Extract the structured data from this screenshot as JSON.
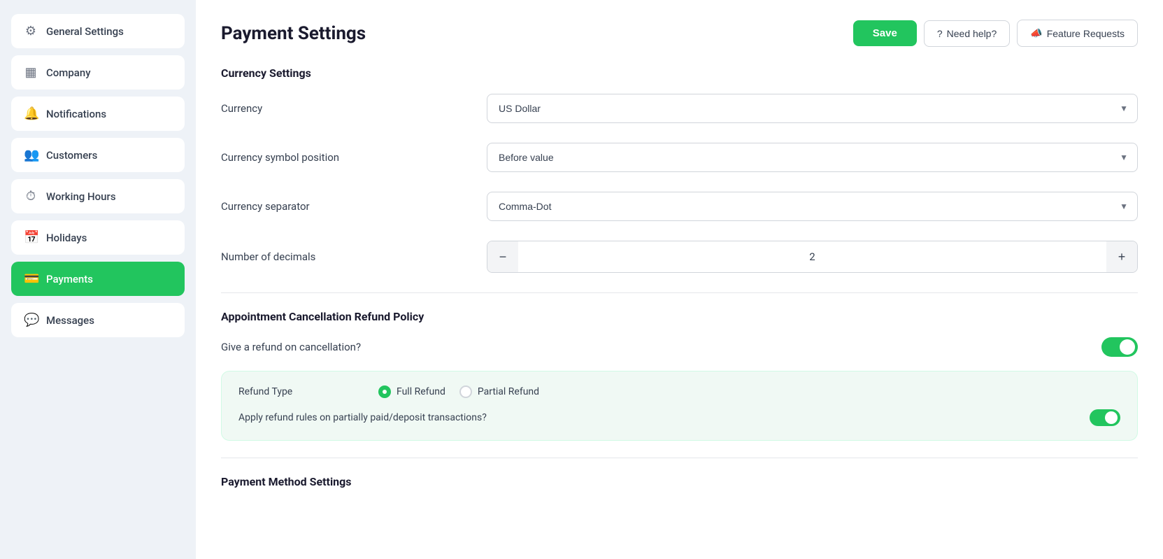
{
  "sidebar": {
    "items": [
      {
        "id": "general-settings",
        "label": "General Settings",
        "icon": "⚙",
        "active": false
      },
      {
        "id": "company",
        "label": "Company",
        "icon": "▦",
        "active": false
      },
      {
        "id": "notifications",
        "label": "Notifications",
        "icon": "🔔",
        "active": false
      },
      {
        "id": "customers",
        "label": "Customers",
        "icon": "👥",
        "active": false
      },
      {
        "id": "working-hours",
        "label": "Working Hours",
        "icon": "⏱",
        "active": false
      },
      {
        "id": "holidays",
        "label": "Holidays",
        "icon": "📅",
        "active": false
      },
      {
        "id": "payments",
        "label": "Payments",
        "icon": "💳",
        "active": true
      },
      {
        "id": "messages",
        "label": "Messages",
        "icon": "💬",
        "active": false
      }
    ]
  },
  "page": {
    "title": "Payment Settings",
    "save_label": "Save",
    "help_label": "Need help?",
    "feature_label": "Feature Requests"
  },
  "currency_settings": {
    "section_title": "Currency Settings",
    "currency_label": "Currency",
    "currency_value": "US Dollar",
    "currency_position_label": "Currency symbol position",
    "currency_position_value": "Before value",
    "currency_separator_label": "Currency separator",
    "currency_separator_value": "Comma-Dot",
    "decimals_label": "Number of decimals",
    "decimals_value": "2",
    "decrement_label": "−",
    "increment_label": "+"
  },
  "refund_policy": {
    "section_title": "Appointment Cancellation Refund Policy",
    "refund_label": "Give a refund on cancellation?",
    "refund_toggle": true,
    "refund_type_label": "Refund Type",
    "full_refund_label": "Full Refund",
    "partial_refund_label": "Partial Refund",
    "full_refund_selected": true,
    "deposit_label": "Apply refund rules on partially paid/deposit transactions?",
    "deposit_toggle": true
  },
  "payment_method": {
    "section_title": "Payment Method Settings"
  },
  "icons": {
    "question": "?",
    "megaphone": "📣"
  }
}
